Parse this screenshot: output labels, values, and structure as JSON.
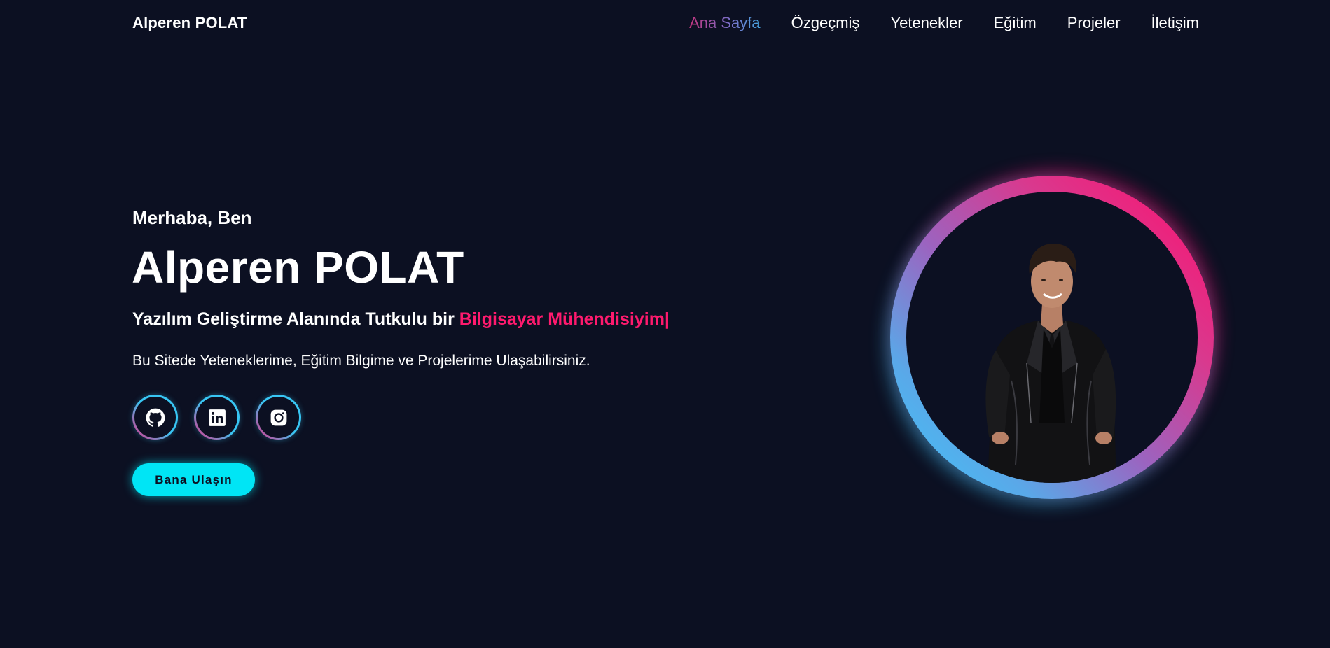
{
  "brand": {
    "name": "Alperen POLAT"
  },
  "nav": {
    "items": [
      {
        "label": "Ana Sayfa",
        "active": true
      },
      {
        "label": "Özgeçmiş",
        "active": false
      },
      {
        "label": "Yetenekler",
        "active": false
      },
      {
        "label": "Eğitim",
        "active": false
      },
      {
        "label": "Projeler",
        "active": false
      },
      {
        "label": "İletişim",
        "active": false
      }
    ]
  },
  "hero": {
    "greeting": "Merhaba, Ben",
    "name": "Alperen POLAT",
    "tagline_prefix": "Yazılım Geliştirme Alanında Tutkulu bir",
    "tagline_highlight": "Bilgisayar Mühendisiyim|",
    "description": "Bu Sitede Yeteneklerime, Eğitim Bilgime ve Projelerime Ulaşabilirsiniz.",
    "cta_label": "Bana Ulaşın"
  },
  "socials": [
    {
      "icon": "github-icon"
    },
    {
      "icon": "linkedin-icon"
    },
    {
      "icon": "instagram-icon"
    }
  ],
  "colors": {
    "background": "#0c1022",
    "accent_pink": "#ff1a6e",
    "accent_cyan": "#00e5f5",
    "ring_blue": "#3cc8fb"
  }
}
